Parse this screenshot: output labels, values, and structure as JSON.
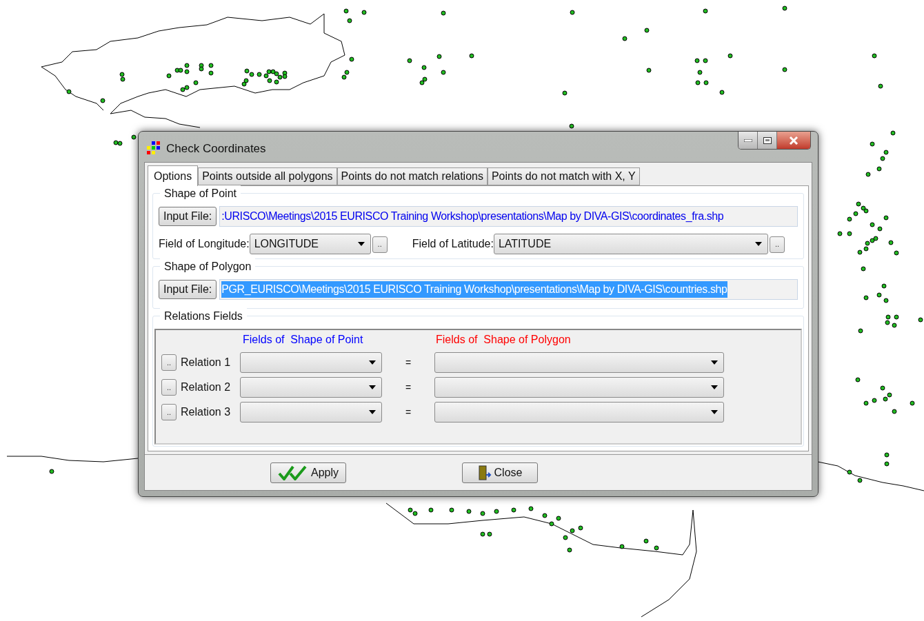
{
  "window": {
    "title": "Check Coordinates"
  },
  "tabs": [
    {
      "label": "Options",
      "selected": true
    },
    {
      "label": "Points outside all polygons",
      "selected": false
    },
    {
      "label": "Points do not match relations",
      "selected": false
    },
    {
      "label": "Points do not match with X, Y",
      "selected": false
    }
  ],
  "shape_of_point": {
    "title": "Shape of Point",
    "button": "Input File:",
    "path": ":URISCO\\Meetings\\2015 EURISCO Training Workshop\\presentations\\Map by DIVA-GIS\\coordinates_fra.shp",
    "path_selected": false,
    "longitude_label": "Field of Longitude:",
    "longitude_value": "LONGITUDE",
    "longitude_button": "..",
    "latitude_label": "Field of Latitude:",
    "latitude_value": "LATITUDE",
    "latitude_button": ".."
  },
  "shape_of_polygon": {
    "title": "Shape of Polygon",
    "button": "Input File:",
    "path": "PGR_EURISCO\\Meetings\\2015 EURISCO Training Workshop\\presentations\\Map by DIVA-GIS\\countries.shp",
    "path_selected": true
  },
  "relations": {
    "title": "Relations Fields",
    "point_heading": "Fields of  Shape of Point",
    "polygon_heading": "Fields of  Shape of Polygon",
    "rows": [
      {
        "button": "..",
        "label": "Relation 1",
        "equals": "="
      },
      {
        "button": "..",
        "label": "Relation 2",
        "equals": "="
      },
      {
        "button": "..",
        "label": "Relation 3",
        "equals": "="
      }
    ]
  },
  "buttons": [
    {
      "kind": "apply",
      "label": "Apply"
    },
    {
      "kind": "close",
      "label": "Close"
    }
  ]
}
